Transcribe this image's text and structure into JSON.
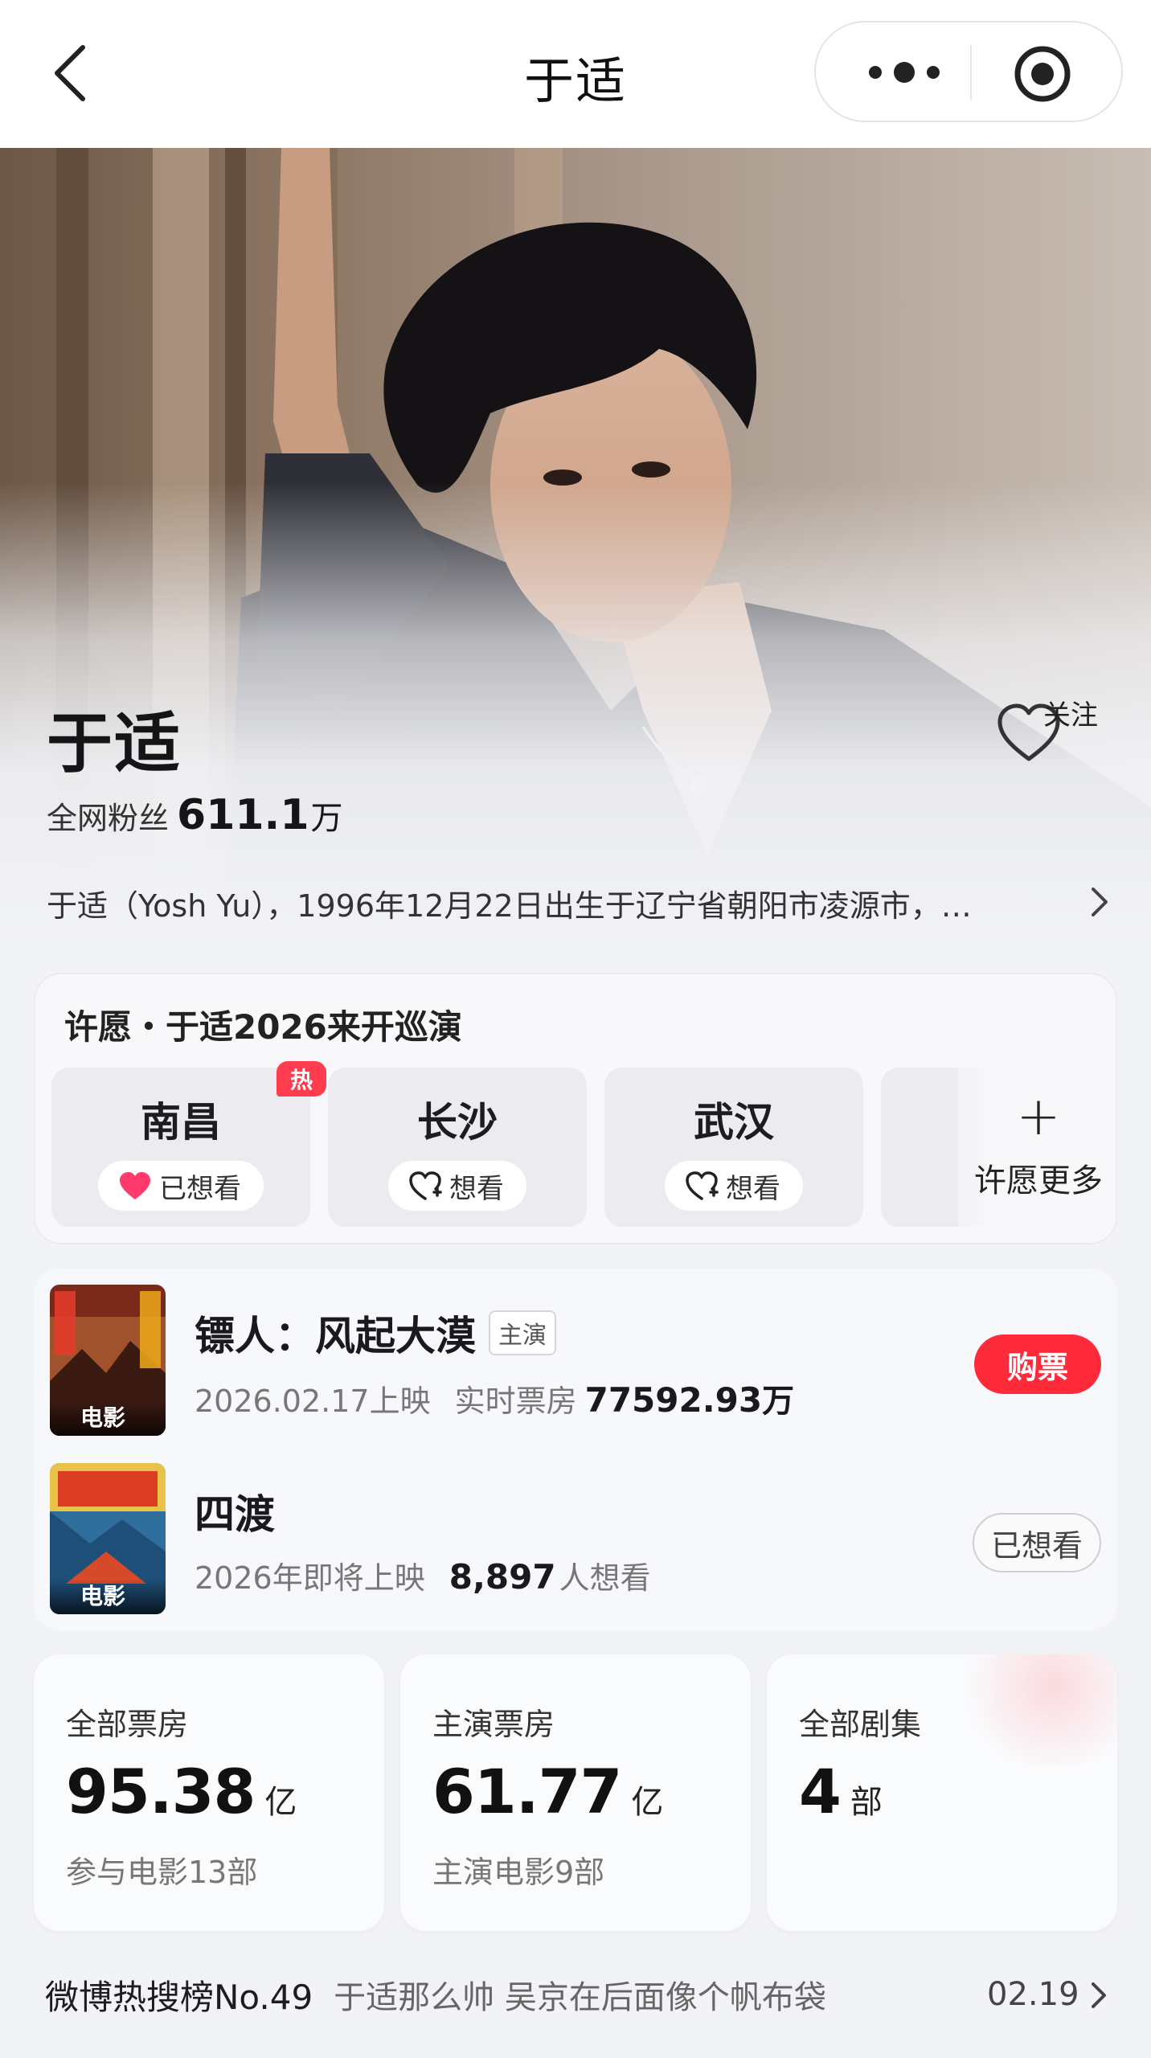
{
  "nav": {
    "title": "于适",
    "back_icon": "chevron-left-icon",
    "more_icon": "more-dots-icon",
    "capsule_close_icon": "target-icon"
  },
  "artist": {
    "name": "于适",
    "follow_label": "关注",
    "fans_label": "全网粉丝",
    "fans_value": "611.1",
    "fans_unit": "万",
    "bio": "于适（Yosh Yu），1996年12月22日出生于辽宁省朝阳市凌源市，…"
  },
  "wish": {
    "title": "许愿・于适2026来开巡演",
    "cities": [
      {
        "name": "南昌",
        "status": "已想看",
        "hot": "热",
        "wished": true
      },
      {
        "name": "长沙",
        "status": "想看",
        "wished": false
      },
      {
        "name": "武汉",
        "status": "想看",
        "wished": false
      }
    ],
    "more_label": "许愿更多",
    "more_plus": "+"
  },
  "films": [
    {
      "title": "镖人：风起大漠",
      "role": "主演",
      "poster_tag": "电影",
      "release": "2026.02.17上映",
      "box_label": "实时票房",
      "box_value": "77592.93",
      "box_unit": "万",
      "action": "购票"
    },
    {
      "title": "四渡",
      "poster_tag": "电影",
      "release": "2026年即将上映",
      "want_value": "8,897",
      "want_label": "人想看",
      "action": "已想看"
    }
  ],
  "stats": [
    {
      "label": "全部票房",
      "value": "95.38",
      "unit": "亿",
      "sub": "参与电影13部"
    },
    {
      "label": "主演票房",
      "value": "61.77",
      "unit": "亿",
      "sub": "主演电影9部"
    },
    {
      "label": "全部剧集",
      "value": "4",
      "unit": "部",
      "sub": ""
    }
  ],
  "hot_search": {
    "rank": "微博热搜榜No.49",
    "topic": "于适那么帅 吴京在后面像个帆布袋",
    "date": "02.19"
  },
  "colors": {
    "accent_red": "#ff2a3a",
    "hot_badge": "#ff3d4f",
    "background": "#f2f3f7"
  }
}
